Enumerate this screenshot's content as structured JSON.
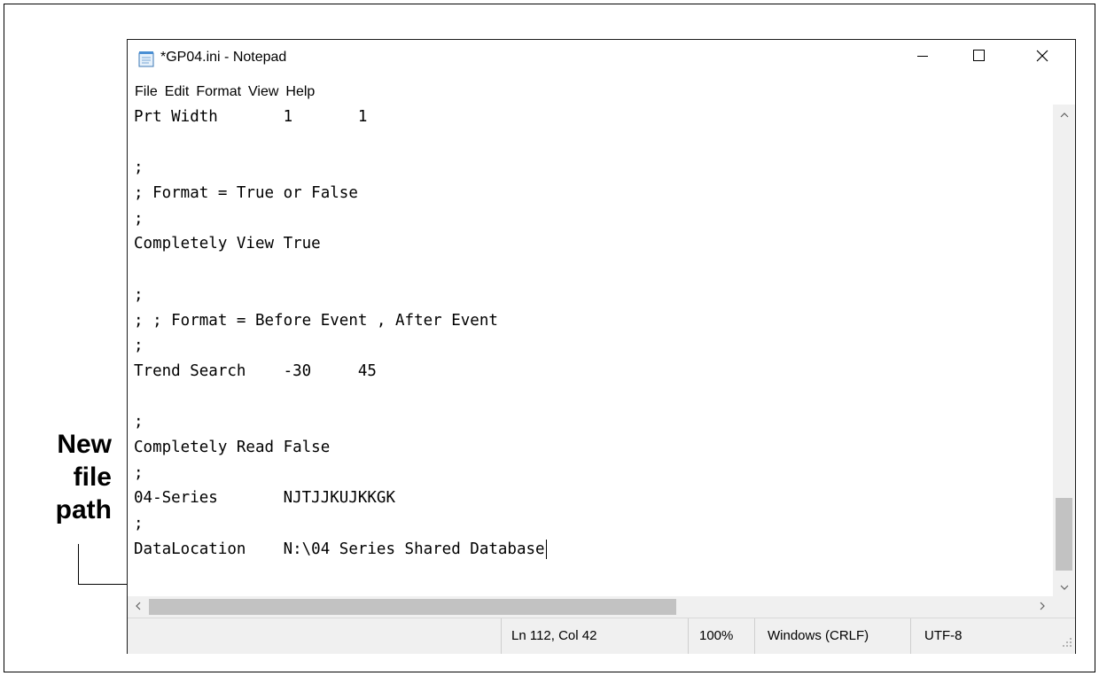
{
  "window": {
    "title": "*GP04.ini - Notepad",
    "icon": "notepad-icon",
    "controls": [
      "minimize-icon",
      "maximize-icon",
      "close-icon"
    ]
  },
  "menu": [
    "File",
    "Edit",
    "Format",
    "View",
    "Help"
  ],
  "editor": {
    "lines": [
      "Prt Width       1       1",
      "",
      ";",
      "; Format = True or False",
      ";",
      "Completely View True",
      "",
      ";",
      "; ; Format = Before Event , After Event",
      ";",
      "Trend Search    -30     45",
      "",
      ";",
      "Completely Read False",
      ";",
      "04-Series       NJTJJKUJKKGK",
      ";",
      "DataLocation    N:\\04 Series Shared Database"
    ]
  },
  "status": {
    "position": "Ln 112, Col 42",
    "zoom": "100%",
    "line_ending": "Windows (CRLF)",
    "encoding": "UTF-8"
  },
  "callout": {
    "lines": [
      "New",
      "file",
      "path"
    ]
  }
}
